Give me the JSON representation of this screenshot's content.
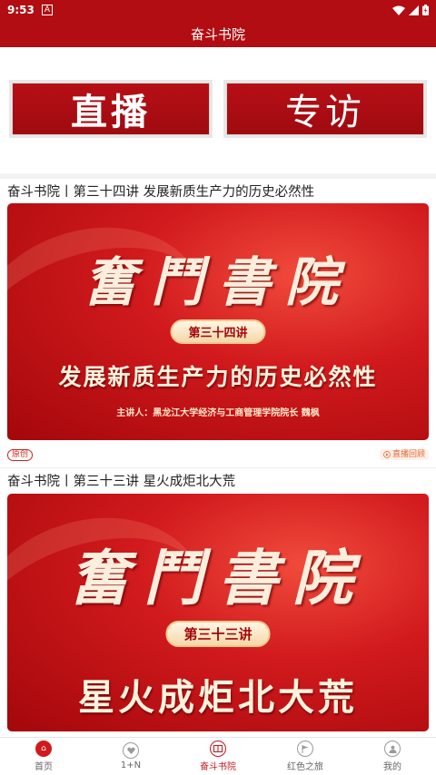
{
  "status_bar": {
    "time": "9:53",
    "notification_icon": "A"
  },
  "header": {
    "title": "奋斗书院"
  },
  "entries": [
    {
      "label": "直播"
    },
    {
      "label": "专访"
    }
  ],
  "articles": [
    {
      "title": "奋斗书院丨第三十四讲 发展新质生产力的历史必然性",
      "cover": {
        "calligraphy": "奮鬥書院",
        "lecture_no": "第三十四讲",
        "subject": "发展新质生产力的历史必然性",
        "lecturer": "主讲人：黑龙江大学经济与工商管理学院院长 魏枫"
      },
      "tag": "原创",
      "badge": "直播回顾"
    },
    {
      "title": "奋斗书院丨第三十三讲 星火成炬北大荒",
      "cover": {
        "calligraphy": "奮鬥書院",
        "lecture_no": "第三十三讲",
        "subject": "星火成炬北大荒"
      }
    }
  ],
  "bottom_nav": [
    {
      "label": "首页",
      "icon": "home-icon"
    },
    {
      "label": "1+N",
      "icon": "heart-icon"
    },
    {
      "label": "奋斗书院",
      "icon": "book-icon",
      "active": true
    },
    {
      "label": "红色之旅",
      "icon": "flag-icon"
    },
    {
      "label": "我的",
      "icon": "user-icon"
    }
  ],
  "colors": {
    "brand_red": "#b10d12",
    "active_red": "#c4161c"
  }
}
